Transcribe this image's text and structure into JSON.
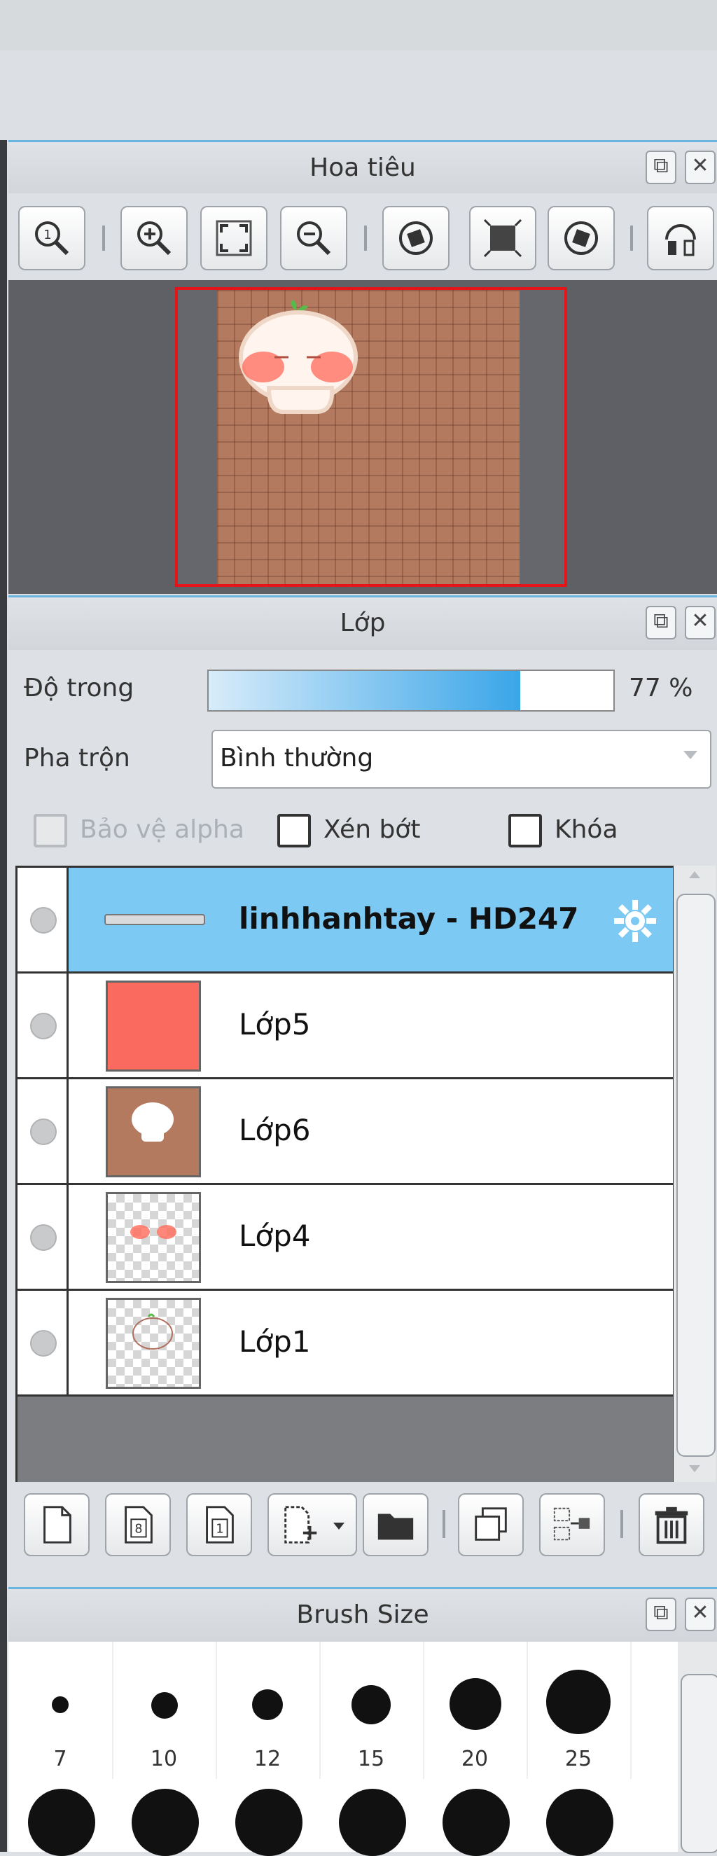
{
  "navigator": {
    "title": "Hoa tiêu"
  },
  "layers_panel": {
    "title": "Lớp",
    "opacity_label": "Độ trong",
    "opacity_value": "77 %",
    "opacity_fraction": 0.77,
    "blend_label": "Pha trộn",
    "blend_value": "Bình thường",
    "protect_alpha_label": "Bảo vệ alpha",
    "clip_label": "Xén bớt",
    "lock_label": "Khóa",
    "layers": [
      {
        "name": "linhhanhtay - HD247",
        "active": true
      },
      {
        "name": "Lớp5",
        "active": false
      },
      {
        "name": "Lớp6",
        "active": false
      },
      {
        "name": "Lớp4",
        "active": false
      },
      {
        "name": "Lớp1",
        "active": false
      }
    ]
  },
  "brush_panel": {
    "title": "Brush Size",
    "sizes": [
      "7",
      "10",
      "12",
      "15",
      "20",
      "25"
    ]
  },
  "colors": {
    "accent": "#3aa6e8",
    "active_layer": "#7ccaf4",
    "canvas_bg": "#b47a5f",
    "frame_red": "#e3141a"
  }
}
